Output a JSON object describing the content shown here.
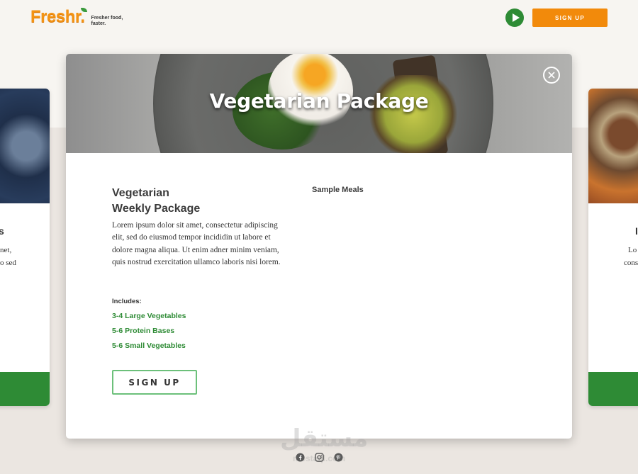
{
  "header": {
    "logo_text": "Freshr.",
    "tagline": "Fresher food, faster.",
    "signup_label": "SIGN UP",
    "play_icon": "play-icon"
  },
  "side_left": {
    "heading_fragment": "s",
    "text_line1": "net,",
    "text_line2": "o sed"
  },
  "side_right": {
    "heading_fragment": "I",
    "text_line1": "Lo",
    "text_line2": "cons"
  },
  "modal": {
    "hero_title": "Vegetarian Package",
    "close_icon": "close-icon",
    "package_title_line1": "Vegetarian",
    "package_title_line2": "Weekly Package",
    "description": "Lorem ipsum dolor sit amet, consectetur adipiscing elit, sed do eiusmod tempor incididin ut labore et dolore magna aliqua. Ut enim adner minim veniam, quis nostrud exercitation ullamco laboris nisi lorem.",
    "includes_label": "Includes:",
    "includes": [
      "3-4 Large Vegetables",
      "5-6 Protein Bases",
      "5-6 Small Vegetables"
    ],
    "signup_label": "SIGN UP",
    "sample_meals_label": "Sample Meals"
  },
  "footer": {
    "social_icons": [
      "facebook-icon",
      "instagram-icon",
      "pinterest-icon"
    ]
  },
  "watermark": {
    "text": "مستقل",
    "sub": "mostaql.com"
  },
  "colors": {
    "brand_orange": "#f28a0b",
    "brand_green": "#2e8b35",
    "page_bg": "#f7f5f1",
    "band_bg": "#ebe6e1"
  }
}
